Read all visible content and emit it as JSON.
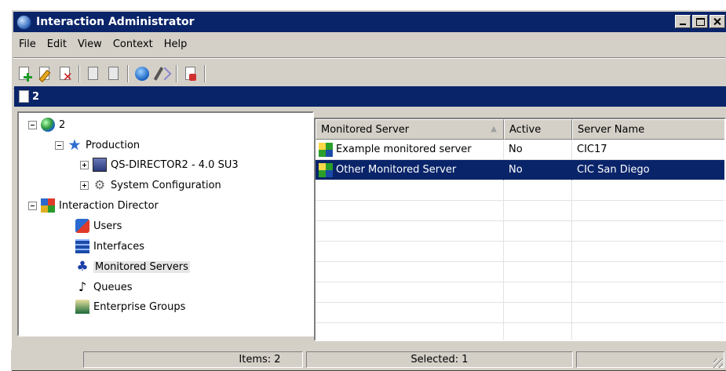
{
  "window": {
    "title": "Interaction Administrator"
  },
  "menu": [
    "File",
    "Edit",
    "View",
    "Context",
    "Help"
  ],
  "toolbar_icons": [
    "new-icon",
    "edit-icon",
    "delete-icon",
    "copy-icon",
    "paste-icon",
    "connect-icon",
    "wizard-icon",
    "properties-icon"
  ],
  "panel": {
    "title": "2"
  },
  "tree": {
    "root": "2",
    "production": "Production",
    "server": "QS-DIRECTOR2 - 4.0 SU3",
    "system_config": "System Configuration",
    "director": "Interaction Director",
    "users": "Users",
    "interfaces": "Interfaces",
    "monitored": "Monitored Servers",
    "queues": "Queues",
    "groups": "Enterprise Groups"
  },
  "list": {
    "columns": [
      "Monitored Server",
      "Active",
      "Server Name"
    ],
    "rows": [
      {
        "name": "Example monitored server",
        "active": "No",
        "server": "CIC17"
      },
      {
        "name": "Other Monitored Server",
        "active": "No",
        "server": "CIC San Diego"
      }
    ]
  },
  "status": {
    "items": "Items: 2",
    "selected": "Selected: 1"
  },
  "colors": {
    "title_bar": "#0a246a",
    "selection": "#0a246a",
    "chrome": "#d4d0c8"
  }
}
